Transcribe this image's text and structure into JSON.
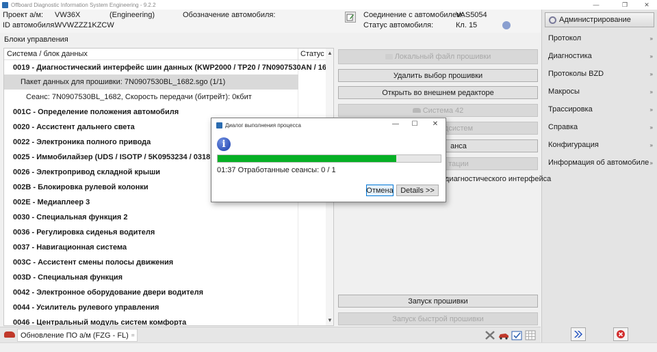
{
  "window": {
    "title": "Offboard Diagnostic Information System Engineering - 9.2.2",
    "minimize": "—",
    "maximize": "❐",
    "close": "✕"
  },
  "header": {
    "project_label": "Проект а/м:",
    "project_value": "VW36X",
    "mode": "(Engineering)",
    "vehicle_designation_label": "Обозначение автомобиля:",
    "vehicle_id_label": "ID автомобиля:",
    "vehicle_id_value": "WVWZZZ1KZCW",
    "connection_label": "Соединение с автомобилем:",
    "connection_value": "VAS5054",
    "status_label": "Статус автомобиля:",
    "status_value": "Кл. 15"
  },
  "right_panel": {
    "admin_button": "Администрирование",
    "items": [
      {
        "label": "Протокол"
      },
      {
        "label": "Диагностика"
      },
      {
        "label": "Протоколы BZD"
      },
      {
        "label": "Макросы"
      },
      {
        "label": "Трассировка"
      },
      {
        "label": "Справка"
      },
      {
        "label": "Конфигурация"
      },
      {
        "label": "Информация об автомобиле"
      }
    ],
    "chevron": "»"
  },
  "main": {
    "section_title": "Блоки управления",
    "tree_header": {
      "col1": "Система / блок данных",
      "col2": "Статус"
    },
    "rows": [
      {
        "text": "0019 - Диагностический интерфейс шин данных  (KWP2000 / TP20 / 7N0907530AN / 16"
      },
      {
        "text": "Пакет данных для прошивки: 7N0907530BL_1682.sgo (1/1)"
      },
      {
        "text": "Сеанс: 7N0907530BL_1682, Скорость передачи (битрейт): 0кбит"
      },
      {
        "text": "001C - Определение положения автомобиля"
      },
      {
        "text": "0020 - Ассистент дальнего света"
      },
      {
        "text": "0022 - Электроника полного привода"
      },
      {
        "text": "0025 - Иммобилайзер  (UDS / ISOTP / 5K0953234 / 0318 / H33"
      },
      {
        "text": "0026 - Электропривод складной крыши"
      },
      {
        "text": "002B - Блокировка рулевой колонки"
      },
      {
        "text": "002E - Медиаплеер 3"
      },
      {
        "text": "0030 - Специальная функция 2"
      },
      {
        "text": "0036 - Регулировка сиденья водителя"
      },
      {
        "text": "0037 - Навигационная система"
      },
      {
        "text": "003C - Ассистент смены полосы движения"
      },
      {
        "text": "003D - Специальная функция"
      },
      {
        "text": "0042 - Электронное оборудование двери водителя"
      },
      {
        "text": "0044 - Усилитель рулевого управления"
      },
      {
        "text": "0046 - Центральный модуль систем комфорта"
      }
    ],
    "buttons": {
      "local_file": "Локальный файл прошивки",
      "delete_selection": "Удалить выбор прошивки",
      "open_external": "Открыть во внешнем редакторе",
      "system42": "Система 42",
      "systems_partial": "дсистем",
      "session_partial": "анса",
      "tation_partial": "тации",
      "start_flash": "Запуск прошивки",
      "start_quick_flash": "Запуск быстрой прошивки"
    },
    "bg_text_diag": "диагностического интерфейса"
  },
  "tabbar": {
    "tab_label": "Обновление ПО а/м (FZG - FL)",
    "tab_close": "⌗"
  },
  "dialog": {
    "title": "Диалог выполнения процесса",
    "win_min": "—",
    "win_max": "☐",
    "win_close": "✕",
    "info_glyph": "i",
    "progress_fraction": 0.8,
    "progress_text": "01:37  Отработанные сеансы: 0 / 1",
    "cancel": "Отмена",
    "details": "Details >>"
  }
}
